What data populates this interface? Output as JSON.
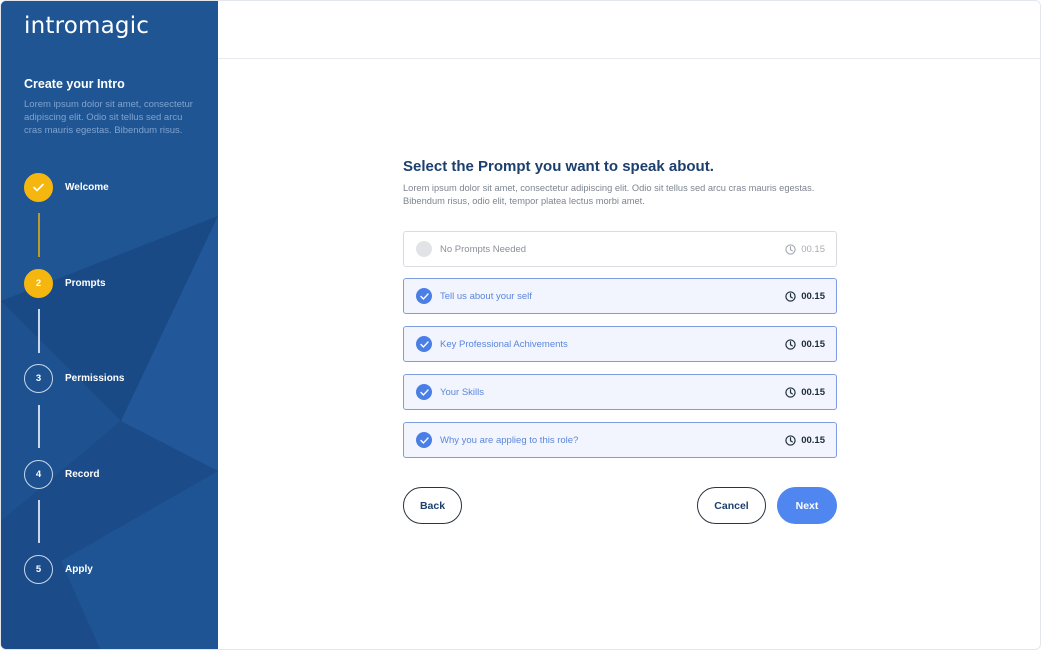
{
  "sidebar": {
    "logo": "intromagic",
    "title": "Create your Intro",
    "description": "Lorem ipsum dolor sit amet, consectetur adipiscing elit. Odio sit tellus sed arcu cras mauris egestas. Bibendum risus.",
    "steps": [
      {
        "number": "",
        "label": "Welcome",
        "state": "done",
        "icon": "check-icon"
      },
      {
        "number": "2",
        "label": "Prompts",
        "state": "active"
      },
      {
        "number": "3",
        "label": "Permissions",
        "state": "pending"
      },
      {
        "number": "4",
        "label": "Record",
        "state": "pending"
      },
      {
        "number": "5",
        "label": "Apply",
        "state": "pending"
      }
    ]
  },
  "main": {
    "heading": "Select the Prompt you want to speak about.",
    "description": "Lorem ipsum dolor sit amet, consectetur adipiscing elit. Odio sit tellus sed arcu cras mauris egestas. Bibendum risus, odio elit, tempor platea lectus morbi amet.",
    "options": [
      {
        "label": "No Prompts Needed",
        "time": "00.15",
        "selected": false
      },
      {
        "label": "Tell us about your self",
        "time": "00.15",
        "selected": true
      },
      {
        "label": "Key Professional Achivements",
        "time": "00.15",
        "selected": true
      },
      {
        "label": "Your Skills",
        "time": "00.15",
        "selected": true
      },
      {
        "label": "Why you are applieg to this role?",
        "time": "00.15",
        "selected": true
      }
    ],
    "buttons": {
      "back": "Back",
      "cancel": "Cancel",
      "next": "Next"
    }
  },
  "colors": {
    "sidebar_bg": "#1d4f8c",
    "step_active": "#f5b70f",
    "accent": "#4f86f0",
    "heading": "#1c3f6e"
  }
}
